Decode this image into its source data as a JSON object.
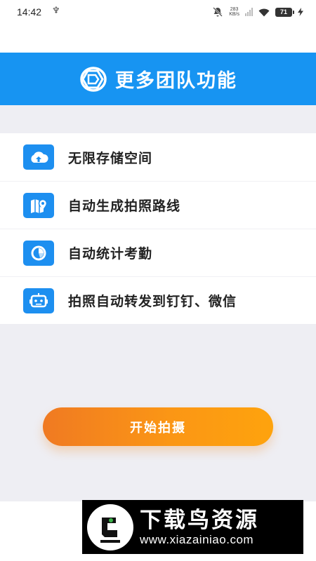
{
  "status_bar": {
    "time": "14:42",
    "usb_icon": "usb-icon",
    "net_speed_value": "283",
    "net_speed_unit": "KB/s",
    "battery_level": "71"
  },
  "banner": {
    "title": "更多团队功能",
    "logo_icon": "team-logo-icon",
    "background_color": "#1794f2"
  },
  "features": [
    {
      "label": "无限存储空间",
      "icon": "cloud-upload-icon"
    },
    {
      "label": "自动生成拍照路线",
      "icon": "map-route-icon"
    },
    {
      "label": "自动统计考勤",
      "icon": "pie-chart-icon"
    },
    {
      "label": "拍照自动转发到钉钉、微信",
      "icon": "robot-icon"
    }
  ],
  "start_button": {
    "label": "开始拍摄",
    "gradient_start": "#f07a22",
    "gradient_end": "#fea30d"
  },
  "watermark": {
    "title": "下载鸟资源",
    "url": "www.xiazainiao.com",
    "logo_icon": "bird-logo-icon"
  }
}
